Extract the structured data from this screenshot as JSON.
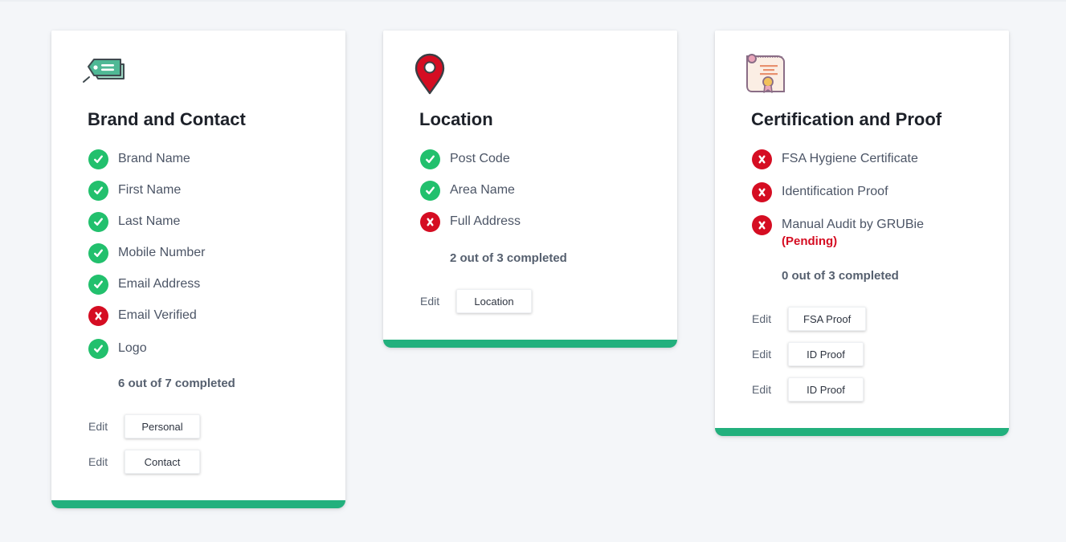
{
  "cards": [
    {
      "title": "Brand and Contact",
      "icon": "tag-icon",
      "items": [
        {
          "label": "Brand Name",
          "status": "done"
        },
        {
          "label": "First Name",
          "status": "done"
        },
        {
          "label": "Last Name",
          "status": "done"
        },
        {
          "label": "Mobile Number",
          "status": "done"
        },
        {
          "label": "Email Address",
          "status": "done"
        },
        {
          "label": "Email Verified",
          "status": "missing"
        },
        {
          "label": "Logo",
          "status": "done"
        }
      ],
      "summary": "6 out of 7 completed",
      "edits": [
        {
          "edit_label": "Edit",
          "button_label": "Personal"
        },
        {
          "edit_label": "Edit",
          "button_label": "Contact"
        }
      ]
    },
    {
      "title": "Location",
      "icon": "map-pin-icon",
      "items": [
        {
          "label": "Post Code",
          "status": "done"
        },
        {
          "label": "Area Name",
          "status": "done"
        },
        {
          "label": "Full Address",
          "status": "missing"
        }
      ],
      "summary": "2 out of 3 completed",
      "edits": [
        {
          "edit_label": "Edit",
          "button_label": "Location"
        }
      ]
    },
    {
      "title": "Certification and Proof",
      "icon": "certificate-icon",
      "items": [
        {
          "label": "FSA Hygiene Certificate",
          "status": "missing"
        },
        {
          "label": "Identification Proof",
          "status": "missing"
        },
        {
          "label": "Manual Audit by GRUBie",
          "status": "missing",
          "note": "(Pending)"
        }
      ],
      "summary": "0 out of 3 completed",
      "edits": [
        {
          "edit_label": "Edit",
          "button_label": "FSA Proof"
        },
        {
          "edit_label": "Edit",
          "button_label": "ID Proof"
        },
        {
          "edit_label": "Edit",
          "button_label": "ID Proof"
        }
      ]
    }
  ],
  "colors": {
    "accent_green": "#22b07d",
    "check_green": "#22c06d",
    "error_red": "#d50d22",
    "background": "#f4f6f9"
  }
}
